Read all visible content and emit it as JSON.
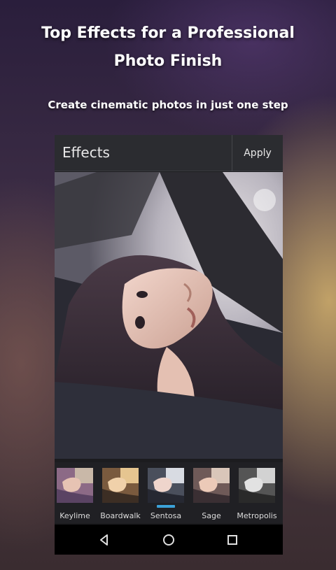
{
  "promo": {
    "headline_line1": "Top Effects for a Professional",
    "headline_line2": "Photo Finish",
    "subline": "Create cinematic photos in just one step"
  },
  "app": {
    "title": "Effects",
    "apply_label": "Apply"
  },
  "effects": [
    {
      "label": "Keylime",
      "selected": false
    },
    {
      "label": "Boardwalk",
      "selected": false
    },
    {
      "label": "Sentosa",
      "selected": true
    },
    {
      "label": "Sage",
      "selected": false
    },
    {
      "label": "Metropolis",
      "selected": false
    }
  ],
  "navigation": {
    "back_icon": "back-triangle-icon",
    "home_icon": "home-circle-icon",
    "recents_icon": "recents-square-icon"
  },
  "colors": {
    "selection_indicator": "#3ba1d8",
    "action_bar": "#2b2c30",
    "text": "#ffffff"
  }
}
